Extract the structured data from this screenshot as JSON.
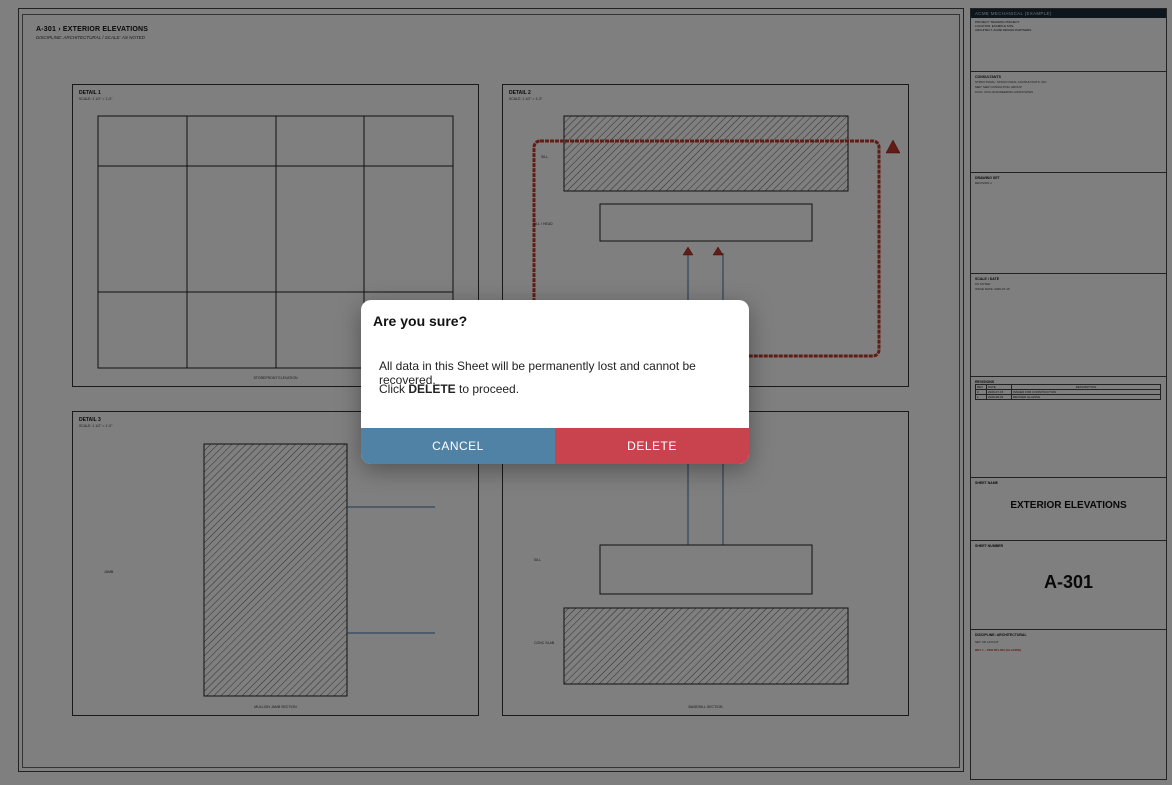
{
  "sheet": {
    "header_title": "A-301  ›  EXTERIOR ELEVATIONS",
    "header_subtitle": "DISCIPLINE: ARCHITECTURAL  /  SCALE: AS NOTED"
  },
  "details": [
    {
      "title": "DETAIL 1",
      "scale": "SCALE: 1 1/2\" = 1'-0\"",
      "caption": "STOREFRONT ELEVATION"
    },
    {
      "title": "DETAIL 2",
      "scale": "SCALE: 1 1/2\" = 1'-0\"",
      "labels": [
        "SILL",
        "SILL / HEAD"
      ]
    },
    {
      "title": "DETAIL 3",
      "scale": "SCALE: 1 1/2\" = 1'-0\"",
      "caption": "MULLION JAMB SECTION",
      "labels": [
        "JAMB"
      ]
    },
    {
      "caption": "BASE/SILL SECTION",
      "labels": [
        "SILL",
        "CONC SLAB"
      ]
    }
  ],
  "title_block": {
    "firm": "ACME MECHANICAL (EXAMPLE)",
    "project_lines": [
      "PROJECT: TRAINING PROJECT",
      "LOCATION: EXAMPLE SITE",
      "ARCHITECT: ACME DESIGN PARTNERS"
    ],
    "consultants_heading": "CONSULTANTS",
    "consultants_lines": [
      "STRUCTURAL: STRUCTURAL CONSULTANTS, INC",
      "MEP: MEP CONSULTING GROUP",
      "CIVIL: CIVIL ENGINEERING ASSOCIATES"
    ],
    "drawing_set_heading": "DRAWING SET",
    "drawing_set_value": "REVISION 1",
    "scale_date_heading": "SCALE / DATE",
    "scale_date_lines": [
      "AS NOTED",
      "ISSUE DATE: 2026-07-15"
    ],
    "revisions_heading": "REVISIONS",
    "revisions_columns": [
      "REV",
      "DATE",
      "DESCRIPTION"
    ],
    "revisions_rows": [
      [
        "0",
        "2026-07-15",
        "ISSUED FOR CONSTRUCTION"
      ],
      [
        "1",
        "2026-08-02",
        "REVISED GLAZING"
      ]
    ],
    "sheet_name_heading": "SHEET NAME",
    "sheet_name": "EXTERIOR ELEVATIONS",
    "sheet_number_heading": "SHEET NUMBER",
    "sheet_number": "A-301",
    "discipline_heading": "DISCIPLINE: ARCHITECTURAL",
    "set_line": "SET: 2D LAYOUT",
    "revision_note": "REV 1 – PER RFI-003 (GLAZING)",
    "revision_note_color": "#c0392b"
  },
  "dialog": {
    "title": "Are you sure?",
    "message": "All data in this Sheet will be permanently lost and cannot be recovered.",
    "confirm_prefix": "Click ",
    "confirm_keyword": "DELETE",
    "confirm_suffix": " to proceed.",
    "cancel_label": "CANCEL",
    "delete_label": "DELETE",
    "cancel_color": "#5082a6",
    "delete_color": "#c8434d"
  }
}
